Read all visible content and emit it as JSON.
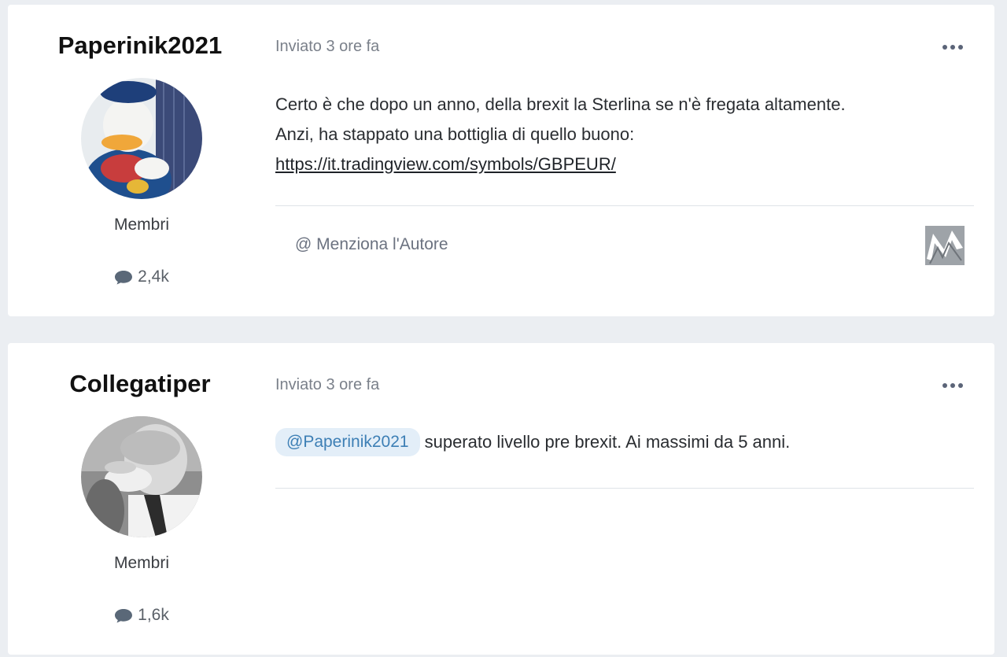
{
  "posts": [
    {
      "author": "Paperinik2021",
      "role": "Membri",
      "post_count": "2,4k",
      "date": "Inviato 3 ore fa",
      "body_lines": [
        "Certo è che dopo un anno, della brexit la Sterlina se n'è fregata altamente.",
        "Anzi, ha stappato una bottiglia di quello buono:"
      ],
      "link": "https://it.tradingview.com/symbols/GBPEUR/",
      "mention_label": "@ Menziona l'Autore",
      "icons": [
        "comment-icon",
        "more-icon",
        "brand-logo"
      ]
    },
    {
      "author": "Collegatiper",
      "role": "Membri",
      "post_count": "1,6k",
      "date": "Inviato 3 ore fa",
      "mention_tag": "@Paperinik2021",
      "body_text": "superato livello pre brexit. Ai massimi da 5 anni.",
      "icons": [
        "comment-icon",
        "more-icon"
      ]
    }
  ],
  "colors": {
    "page_bg": "#ebeef2",
    "card_bg": "#ffffff",
    "mention_bg": "#e3eef8",
    "mention_text": "#3d7fb5"
  }
}
